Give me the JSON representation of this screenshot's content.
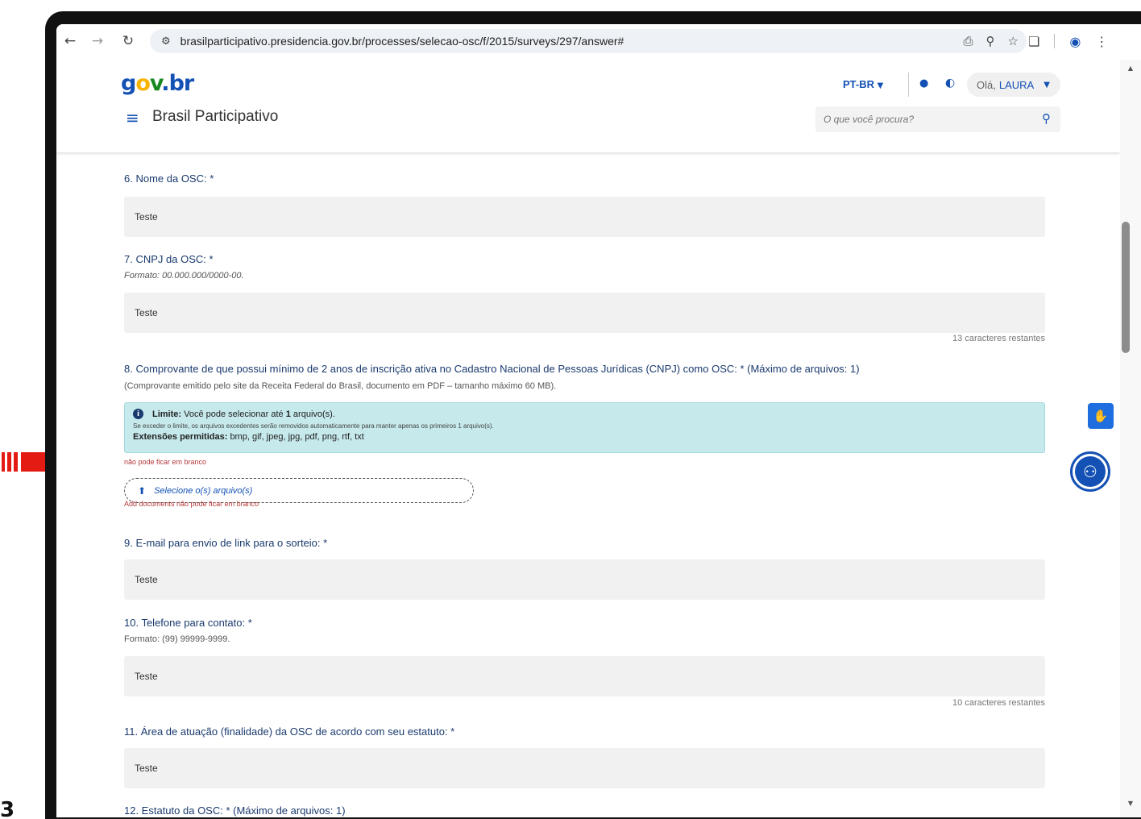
{
  "side_number": "3",
  "colors": {
    "brand_blue": "#1351b4",
    "arrow_red": "#e41b13",
    "alert_bg": "#c6e9ec",
    "error_red": "#b53838"
  },
  "browser": {
    "url": "brasilparticipativo.presidencia.gov.br/processes/selecao-osc/f/2015/surveys/297/answer#",
    "icons": [
      "back-icon",
      "forward-icon",
      "reload-icon",
      "site-info-icon",
      "install-icon",
      "zoom-icon",
      "bookmark-star-icon",
      "extensions-icon",
      "profile-icon",
      "more-menu-icon"
    ]
  },
  "header": {
    "logo_g": "g",
    "logo_o": "o",
    "logo_v": "v",
    "logo_dot": ".",
    "logo_br": "br",
    "site_title": "Brasil Participativo",
    "language": "PT-BR",
    "greeting": "Olá,",
    "user_name": "LAURA",
    "search_placeholder": "O que você procura?"
  },
  "form": {
    "q6": {
      "label": "6. Nome da OSC: *",
      "value": "Teste"
    },
    "q7": {
      "label": "7. CNPJ da OSC: *",
      "hint": "Formato: 00.000.000/0000-00.",
      "value": "Teste",
      "chars_left": "13 caracteres restantes"
    },
    "q8": {
      "label": "8. Comprovante de que possui mínimo de 2 anos de inscrição ativa no Cadastro Nacional de Pessoas Jurídicas (CNPJ) como OSC: * (Máximo de arquivos: 1)",
      "hint": "(Comprovante emitido pelo site da Receita Federal do Brasil, documento em PDF – tamanho máximo 60 MB).",
      "alert_limit_label": "Limite:",
      "alert_limit_text_pre": "Você pode selecionar até",
      "alert_limit_count": "1",
      "alert_limit_text_post": "arquivo(s).",
      "alert_note": "Se exceder o limite, os arquivos excedentes serão removidos automaticamente para manter apenas os primeiros 1 arquivo(s).",
      "alert_ext_label": "Extensões permitidas:",
      "alert_ext_value": "bmp, gif, jpeg, jpg, pdf, png, rtf, txt",
      "error_blank": "não pode ficar em branco",
      "upload_label": "Selecione o(s) arquivo(s)",
      "error_docs": "Add documents não pode ficar em branco"
    },
    "q9": {
      "label": "9. E-mail para envio de link para o sorteio: *",
      "value": "Teste"
    },
    "q10": {
      "label": "10. Telefone para contato: *",
      "hint": "Formato: (99) 99999-9999.",
      "value": "Teste",
      "chars_left": "10 caracteres restantes"
    },
    "q11": {
      "label": "11. Área de atuação (finalidade) da OSC de acordo com seu estatuto: *",
      "value": "Teste"
    },
    "q12": {
      "label": "12. Estatuto da OSC: * (Máximo de arquivos: 1)"
    }
  }
}
